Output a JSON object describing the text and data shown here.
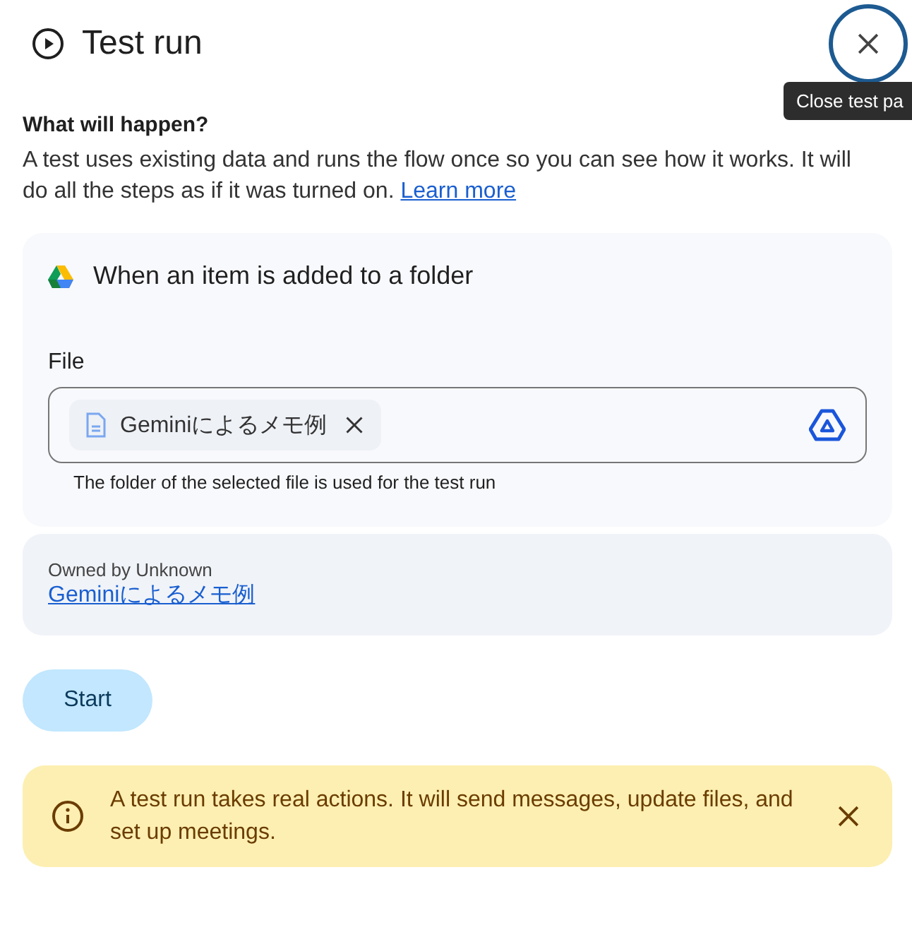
{
  "header": {
    "title": "Test run",
    "close_tooltip": "Close test pa"
  },
  "intro": {
    "heading": "What will happen?",
    "text": "A test uses existing data and runs the flow once so you can see how it works. It will do all the steps as if it was turned on.",
    "link": "Learn more"
  },
  "trigger": {
    "title": "When an item is added to a folder",
    "field_label": "File",
    "chip": "Geminiによるメモ例",
    "helper": "The folder of the selected file is used for the test run"
  },
  "owner": {
    "text": "Owned by Unknown",
    "link": "Geminiによるメモ例"
  },
  "start_button": "Start",
  "warning": {
    "text": "A test run takes real actions. It will send messages, update files, and set up meetings."
  }
}
